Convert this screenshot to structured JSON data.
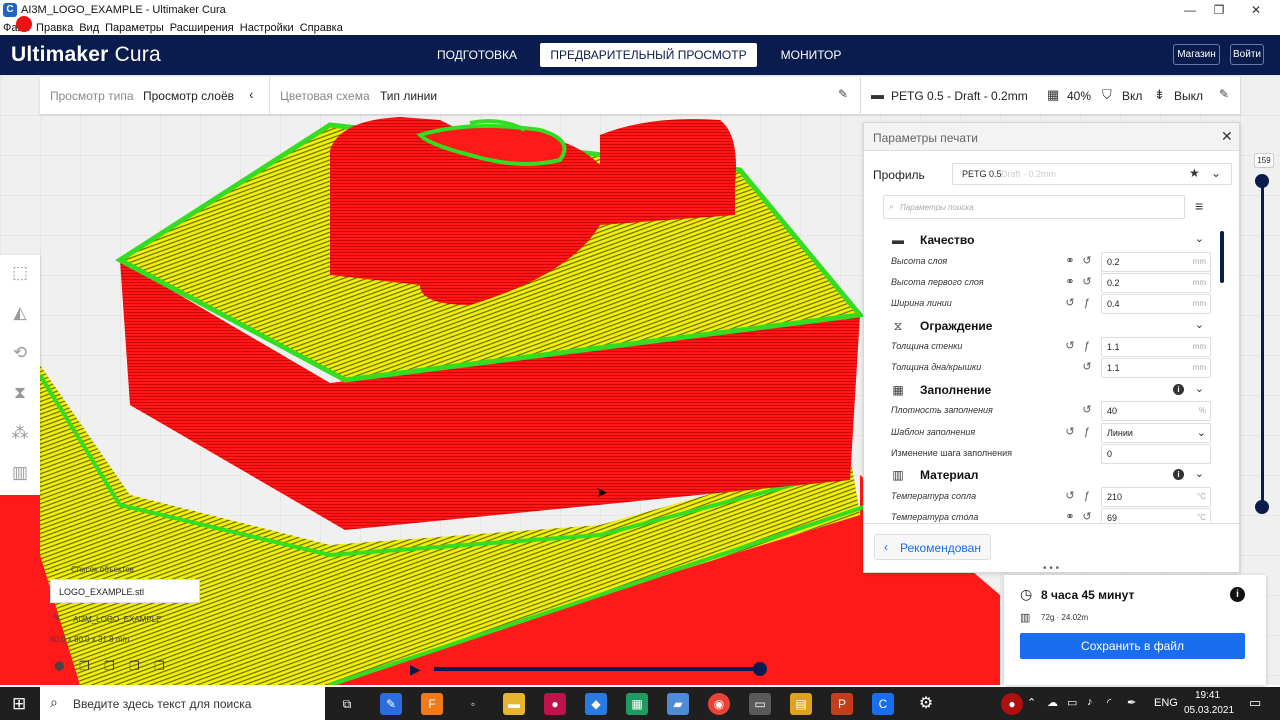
{
  "window": {
    "title": "AI3M_LOGO_EXAMPLE - Ultimaker Cura",
    "controls": {
      "minimize": "—",
      "maximize": "❐",
      "close": "✕"
    }
  },
  "menu": [
    "Файл",
    "Правка",
    "Вид",
    "Параметры",
    "Расширения",
    "Настройки",
    "Справка"
  ],
  "header": {
    "logo_bold": "Ultimaker",
    "logo_light": "Cura",
    "stages": [
      "ПОДГОТОВКА",
      "ПРЕДВАРИТЕЛЬНЫЙ ПРОСМОТР",
      "МОНИТОР"
    ],
    "active_stage": "ПРЕДВАРИТЕЛЬНЫЙ ПРОСМОТР",
    "store_label": "Магазин",
    "signin_label": "Войти"
  },
  "viewbar": {
    "view_type_label": "Просмотр типа",
    "view_type_value": "Просмотр слоёв",
    "color_scheme_label": "Цветовая схема",
    "color_scheme_value": "Тип линии"
  },
  "printbar": {
    "profile": "PETG 0.5 - Draft - 0.2mm",
    "infill": "40%",
    "support": "Вкл",
    "adhesion": "Выкл"
  },
  "layer_slider": {
    "current_layer": "159",
    "max_layer": 159
  },
  "panel": {
    "title": "Параметры печати",
    "profile_label": "Профиль",
    "profile_value": "PETG 0.5",
    "profile_sub": "Draft - 0.2mm",
    "search_placeholder": "Параметры поиска",
    "categories": {
      "quality": "Качество",
      "shell": "Ограждение",
      "infill": "Заполнение",
      "material": "Материал"
    },
    "settings": [
      {
        "label": "Высота слоя",
        "value": "0.2",
        "unit": "mm"
      },
      {
        "label": "Высота первого слоя",
        "value": "0.2",
        "unit": "mm"
      },
      {
        "label": "Ширина линии",
        "value": "0.4",
        "unit": "mm"
      },
      {
        "label": "Толщина стенки",
        "value": "1.1",
        "unit": "mm"
      },
      {
        "label": "Толщина дна/крышки",
        "value": "1.1",
        "unit": "mm"
      },
      {
        "label": "Плотность заполнения",
        "value": "40",
        "unit": "%"
      },
      {
        "label": "Шаблон заполнения",
        "value": "Линии",
        "unit": ""
      },
      {
        "label": "Изменение шага заполнения",
        "value": "0",
        "unit": ""
      },
      {
        "label": "Температура сопла",
        "value": "210",
        "unit": "°C"
      },
      {
        "label": "Температура стола",
        "value": "69",
        "unit": "°C"
      }
    ],
    "recommended_label": "Рекомендован"
  },
  "objects": {
    "list_label": "Список объектов",
    "file_name": "LOGO_EXAMPLE.stl",
    "object_name": "AI3M_LOGO_EXAMPLE",
    "dimensions": "80.0 x 80.0 x 31.8 mm"
  },
  "printinfo": {
    "time": "8 часа 45 минут",
    "material": "72g · 24.02m",
    "save_label": "Сохранить в файл"
  },
  "taskbar": {
    "search_placeholder": "Введите здесь текст для поиска",
    "lang": "ENG",
    "time": "19:41",
    "date": "05.03.2021"
  },
  "colors": {
    "header": "#0a1b4d",
    "accent": "#196ef0",
    "model_wall": "#ff1a1a",
    "model_top": "#ffff00",
    "outline": "#33dd22"
  }
}
